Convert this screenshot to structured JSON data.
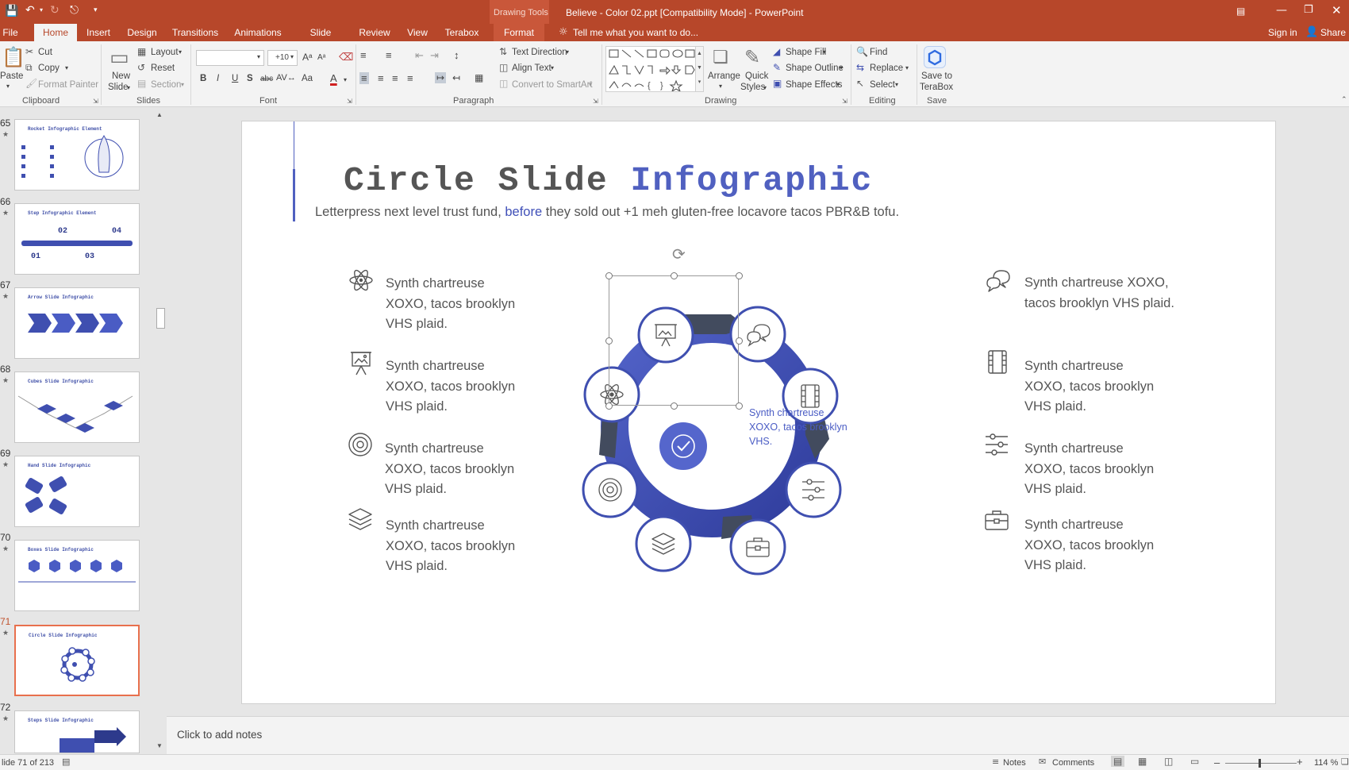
{
  "window": {
    "title": "Believe - Color 02.ppt [Compatibility Mode] - PowerPoint",
    "context_group": "Drawing Tools"
  },
  "tabs": [
    "File",
    "Home",
    "Insert",
    "Design",
    "Transitions",
    "Animations",
    "Slide Show",
    "Review",
    "View",
    "Terabox",
    "Format"
  ],
  "tell_me": "Tell me what you want to do...",
  "account": {
    "sign_in": "Sign in",
    "share": "Share"
  },
  "ribbon": {
    "clipboard": {
      "paste": "Paste",
      "cut": "Cut",
      "copy": "Copy",
      "format_painter": "Format Painter",
      "label": "Clipboard"
    },
    "slides": {
      "new_slide_1": "New",
      "new_slide_2": "Slide",
      "layout": "Layout",
      "reset": "Reset",
      "section": "Section",
      "label": "Slides"
    },
    "font": {
      "size": "+10",
      "label": "Font"
    },
    "paragraph": {
      "text_direction": "Text Direction",
      "align_text": "Align Text",
      "convert": "Convert to SmartArt",
      "label": "Paragraph"
    },
    "drawing": {
      "arrange": "Arrange",
      "quick_styles_1": "Quick",
      "quick_styles_2": "Styles",
      "shape_fill": "Shape Fill",
      "shape_outline": "Shape Outline",
      "shape_effects": "Shape Effects",
      "label": "Drawing"
    },
    "editing": {
      "find": "Find",
      "replace": "Replace",
      "select": "Select",
      "label": "Editing"
    },
    "save": {
      "line1": "Save to",
      "line2": "TeraBox",
      "label": "Save"
    }
  },
  "thumbnails": [
    {
      "num": "65",
      "title": "Rocket Infographic Element"
    },
    {
      "num": "66",
      "title": "Step Infographic Element"
    },
    {
      "num": "67",
      "title": "Arrow Slide Infographic"
    },
    {
      "num": "68",
      "title": "Cubes Slide Infographic"
    },
    {
      "num": "69",
      "title": "Hand Slide Infographic"
    },
    {
      "num": "70",
      "title": "Boxes Slide Infographic"
    },
    {
      "num": "71",
      "title": "Circle Slide Infographic"
    },
    {
      "num": "72",
      "title": "Steps Slide Infographic"
    }
  ],
  "slide": {
    "title_a": "Circle Slide ",
    "title_b": "Infographic",
    "sub_a": "Letterpress next level trust fund, ",
    "sub_b": "before",
    "sub_c": " they sold out +1 meh gluten-free locavore tacos PBR&B tofu.",
    "left": [
      {
        "l1": "Synth chartreuse",
        "l2": "XOXO, tacos brooklyn",
        "l3": "VHS plaid."
      },
      {
        "l1": "Synth chartreuse",
        "l2": "XOXO, tacos brooklyn",
        "l3": "VHS plaid."
      },
      {
        "l1": "Synth chartreuse",
        "l2": "XOXO, tacos brooklyn",
        "l3": "VHS plaid."
      },
      {
        "l1": "Synth chartreuse",
        "l2": "XOXO, tacos brooklyn",
        "l3": "VHS plaid."
      }
    ],
    "right": [
      {
        "l1": "Synth chartreuse XOXO,",
        "l2": "tacos brooklyn VHS plaid.",
        "l3": ""
      },
      {
        "l1": "Synth chartreuse",
        "l2": "XOXO, tacos brooklyn",
        "l3": "VHS plaid."
      },
      {
        "l1": "Synth chartreuse",
        "l2": "XOXO, tacos brooklyn",
        "l3": "VHS plaid."
      },
      {
        "l1": "Synth chartreuse",
        "l2": "XOXO, tacos brooklyn",
        "l3": "VHS plaid."
      }
    ],
    "center": {
      "l1": "Synth chartreuse",
      "l2": "XOXO, tacos brooklyn",
      "l3": "VHS."
    }
  },
  "notes_placeholder": "Click to add notes",
  "status": {
    "slide": "lide 71 of 213",
    "notes": "Notes",
    "comments": "Comments",
    "zoom": "114 %"
  },
  "colors": {
    "accent": "#b7472a",
    "brand_blue": "#3f4fb0",
    "dark": "#424b5e"
  }
}
